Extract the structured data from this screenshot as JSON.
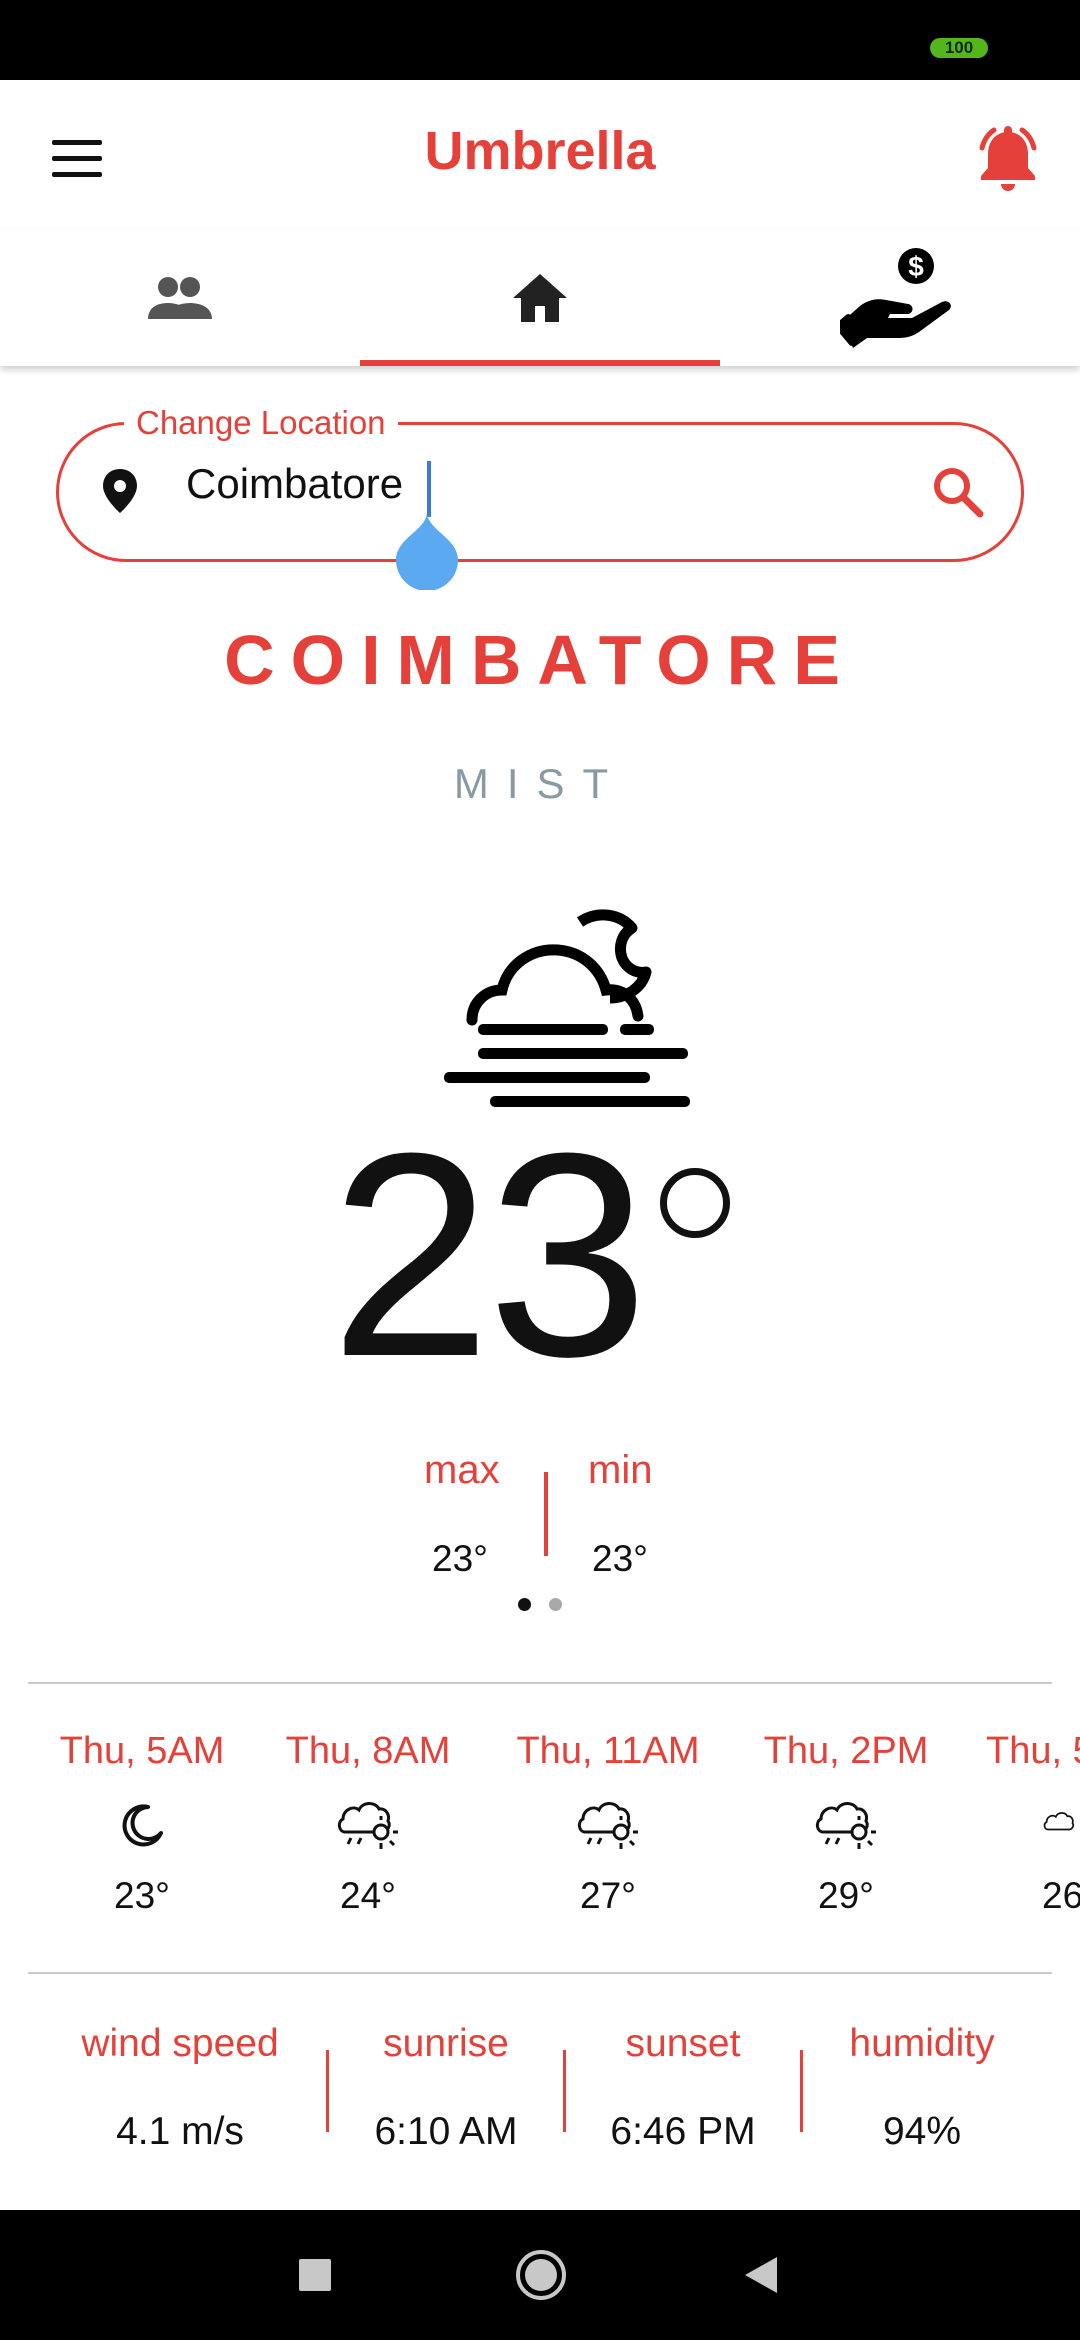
{
  "status_bar": {
    "battery": "100"
  },
  "app_bar": {
    "title": "Umbrella"
  },
  "tabs": [
    {
      "name": "people",
      "icon": "people-icon"
    },
    {
      "name": "home",
      "icon": "home-icon",
      "selected": true
    },
    {
      "name": "donate",
      "icon": "donate-hand-icon"
    }
  ],
  "location": {
    "label": "Change Location",
    "value": "Coimbatore"
  },
  "current": {
    "city": "COIMBATORE",
    "condition": "MIST",
    "icon": "fog-night-icon",
    "temperature": "23",
    "max_label": "max",
    "min_label": "min",
    "max": "23°",
    "min": "23°"
  },
  "pager": {
    "pages": 2,
    "active": 0
  },
  "hourly": [
    {
      "time": "Thu, 5AM",
      "icon": "moon-icon",
      "temp": "23°"
    },
    {
      "time": "Thu, 8AM",
      "icon": "cloud-sun-rain-icon",
      "temp": "24°"
    },
    {
      "time": "Thu, 11AM",
      "icon": "cloud-sun-rain-icon",
      "temp": "27°"
    },
    {
      "time": "Thu, 2PM",
      "icon": "cloud-sun-rain-icon",
      "temp": "29°"
    },
    {
      "time": "Thu, 5",
      "icon": "cloud-sun-rain-icon",
      "temp": "26"
    }
  ],
  "stats": [
    {
      "label": "wind speed",
      "value": "4.1 m/s"
    },
    {
      "label": "sunrise",
      "value": "6:10 AM"
    },
    {
      "label": "sunset",
      "value": "6:46 PM"
    },
    {
      "label": "humidity",
      "value": "94%"
    }
  ],
  "colors": {
    "accent": "#e5413a",
    "condition_text": "#8a9aa3",
    "battery": "#55b61b"
  }
}
